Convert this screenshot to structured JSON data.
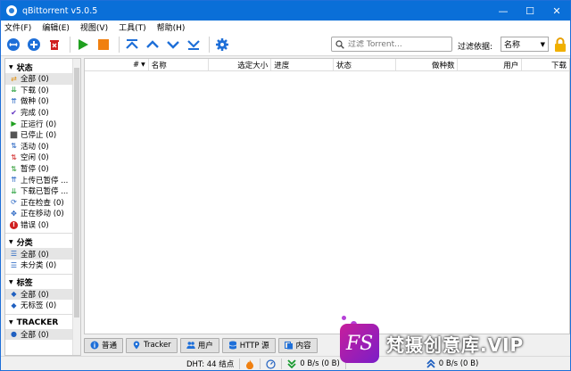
{
  "window": {
    "title": "qBittorrent v5.0.5",
    "minimize": "—",
    "maximize": "☐",
    "close": "✕"
  },
  "menu": [
    "文件(F)",
    "编辑(E)",
    "视图(V)",
    "工具(T)",
    "帮助(H)"
  ],
  "toolbar": {
    "search_placeholder": "过滤 Torrent...",
    "filter_label": "过滤依据:",
    "filter_value": "名称"
  },
  "sidebar": {
    "status_title": "状态",
    "status_items": [
      {
        "label": "全部 (0)",
        "icon": "shuffle-icon",
        "color": "#e09010",
        "glyph": "⇄"
      },
      {
        "label": "下载 (0)",
        "icon": "download-icon",
        "color": "#1a9a30",
        "glyph": "⇊"
      },
      {
        "label": "做种 (0)",
        "icon": "upload-icon",
        "color": "#2060c0",
        "glyph": "⇈"
      },
      {
        "label": "完成 (0)",
        "icon": "check-icon",
        "color": "#6030c0",
        "glyph": "✔"
      },
      {
        "label": "正运行 (0)",
        "icon": "play-icon",
        "color": "#20a020",
        "glyph": "▶"
      },
      {
        "label": "已停止 (0)",
        "icon": "stop-icon",
        "color": "#555555",
        "glyph": "■"
      },
      {
        "label": "活动 (0)",
        "icon": "active-icon",
        "color": "#2060c0",
        "glyph": "⇅"
      },
      {
        "label": "空闲 (0)",
        "icon": "inactive-icon",
        "color": "#d02020",
        "glyph": "⇅"
      },
      {
        "label": "暂停 (0)",
        "icon": "stalled-icon",
        "color": "#2a9a30",
        "glyph": "⇅"
      },
      {
        "label": "上传已暂停 ...",
        "icon": "stalled-upload-icon",
        "color": "#2060c0",
        "glyph": "⇈"
      },
      {
        "label": "下载已暂停 ...",
        "icon": "stalled-download-icon",
        "color": "#1a9a30",
        "glyph": "⇊"
      },
      {
        "label": "正在检查 (0)",
        "icon": "checking-icon",
        "color": "#2060c0",
        "glyph": "⟳"
      },
      {
        "label": "正在移动 (0)",
        "icon": "moving-icon",
        "color": "#2060c0",
        "glyph": "✥"
      },
      {
        "label": "错误 (0)",
        "icon": "error-icon",
        "color": "#d02020",
        "glyph": "!"
      }
    ],
    "categories_title": "分类",
    "category_items": [
      {
        "label": "全部 (0)",
        "icon": "list-icon",
        "color": "#2060c0",
        "glyph": "☰"
      },
      {
        "label": "未分类 (0)",
        "icon": "list-icon",
        "color": "#2060c0",
        "glyph": "☰"
      }
    ],
    "tags_title": "标签",
    "tag_items": [
      {
        "label": "全部 (0)",
        "icon": "tag-icon",
        "color": "#2060c0",
        "glyph": "◆"
      },
      {
        "label": "无标签 (0)",
        "icon": "tag-icon",
        "color": "#2060c0",
        "glyph": "◆"
      }
    ],
    "trackers_title": "TRACKER",
    "tracker_items": [
      {
        "label": "全部 (0)",
        "icon": "location-pin-icon",
        "color": "#2060c0",
        "glyph": "●"
      }
    ]
  },
  "table": {
    "columns": [
      "#",
      "名称",
      "选定大小",
      "进度",
      "状态",
      "做种数",
      "用户",
      "下载"
    ]
  },
  "tabs": [
    {
      "label": "普通",
      "icon": "info-icon"
    },
    {
      "label": "Tracker",
      "icon": "pin-icon"
    },
    {
      "label": "用户",
      "icon": "users-icon"
    },
    {
      "label": "HTTP 源",
      "icon": "server-icon"
    },
    {
      "label": "内容",
      "icon": "files-icon"
    }
  ],
  "statusbar": {
    "dht": "DHT:  44 结点",
    "download": "0 B/s (0 B)",
    "upload": "0 B/s (0 B)"
  },
  "watermark": {
    "logo": "FS",
    "text": "梵摄创意库.VIP"
  }
}
